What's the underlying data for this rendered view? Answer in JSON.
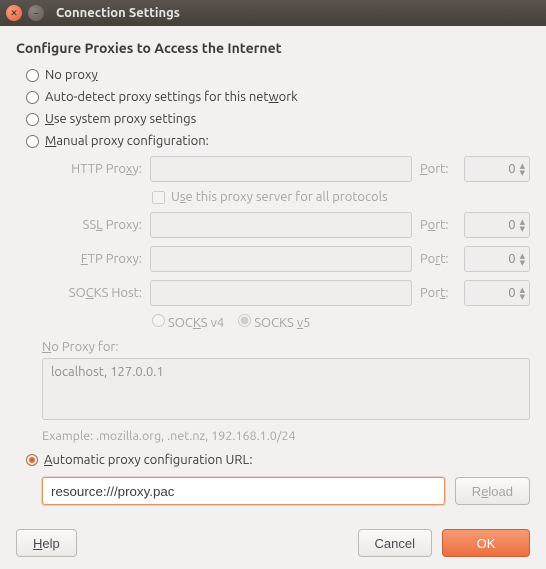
{
  "window": {
    "title": "Connection Settings"
  },
  "heading": "Configure Proxies to Access the Internet",
  "radios": {
    "no_proxy": {
      "pre": "No prox",
      "u": "y",
      "post": ""
    },
    "auto_detect": {
      "pre": "Auto-detect proxy settings for this net",
      "u": "w",
      "post": "ork"
    },
    "system": {
      "pre": "",
      "u": "U",
      "post": "se system proxy settings"
    },
    "manual": {
      "pre": "",
      "u": "M",
      "post": "anual proxy configuration:"
    },
    "autoconf": {
      "pre": "",
      "u": "A",
      "post": "utomatic proxy configuration URL:"
    }
  },
  "manual": {
    "http": {
      "label_pre": "HTTP Pro",
      "label_u": "x",
      "label_post": "y:",
      "value": "",
      "port_pre": "",
      "port_u": "P",
      "port_post": "ort:",
      "port": "0"
    },
    "use_all": {
      "pre": "U",
      "u": "s",
      "post": "e this proxy server for all protocols"
    },
    "ssl": {
      "label_pre": "SS",
      "label_u": "L",
      "label_post": " Proxy:",
      "value": "",
      "port_pre": "P",
      "port_u": "o",
      "port_post": "rt:",
      "port": "0"
    },
    "ftp": {
      "label_pre": "",
      "label_u": "F",
      "label_post": "TP Proxy:",
      "value": "",
      "port_pre": "Po",
      "port_u": "r",
      "port_post": "t:",
      "port": "0"
    },
    "socks": {
      "label_pre": "SO",
      "label_u": "C",
      "label_post": "KS Host:",
      "value": "",
      "port_pre": "Por",
      "port_u": "t",
      "port_post": ":",
      "port": "0"
    },
    "socks_v4": {
      "pre": "SOC",
      "u": "K",
      "post": "S v4"
    },
    "socks_v5": {
      "pre": "SOCKS ",
      "u": "v",
      "post": "5"
    },
    "noproxy_label": {
      "pre": "",
      "u": "N",
      "post": "o Proxy for:"
    },
    "noproxy_value": "localhost, 127.0.0.1",
    "example": "Example: .mozilla.org, .net.nz, 192.168.1.0/24"
  },
  "autoconf": {
    "url": "resource:///proxy.pac",
    "reload": {
      "pre": "R",
      "u": "e",
      "post": "load"
    }
  },
  "buttons": {
    "help": {
      "pre": "",
      "u": "H",
      "post": "elp"
    },
    "cancel": "Cancel",
    "ok": "OK"
  }
}
